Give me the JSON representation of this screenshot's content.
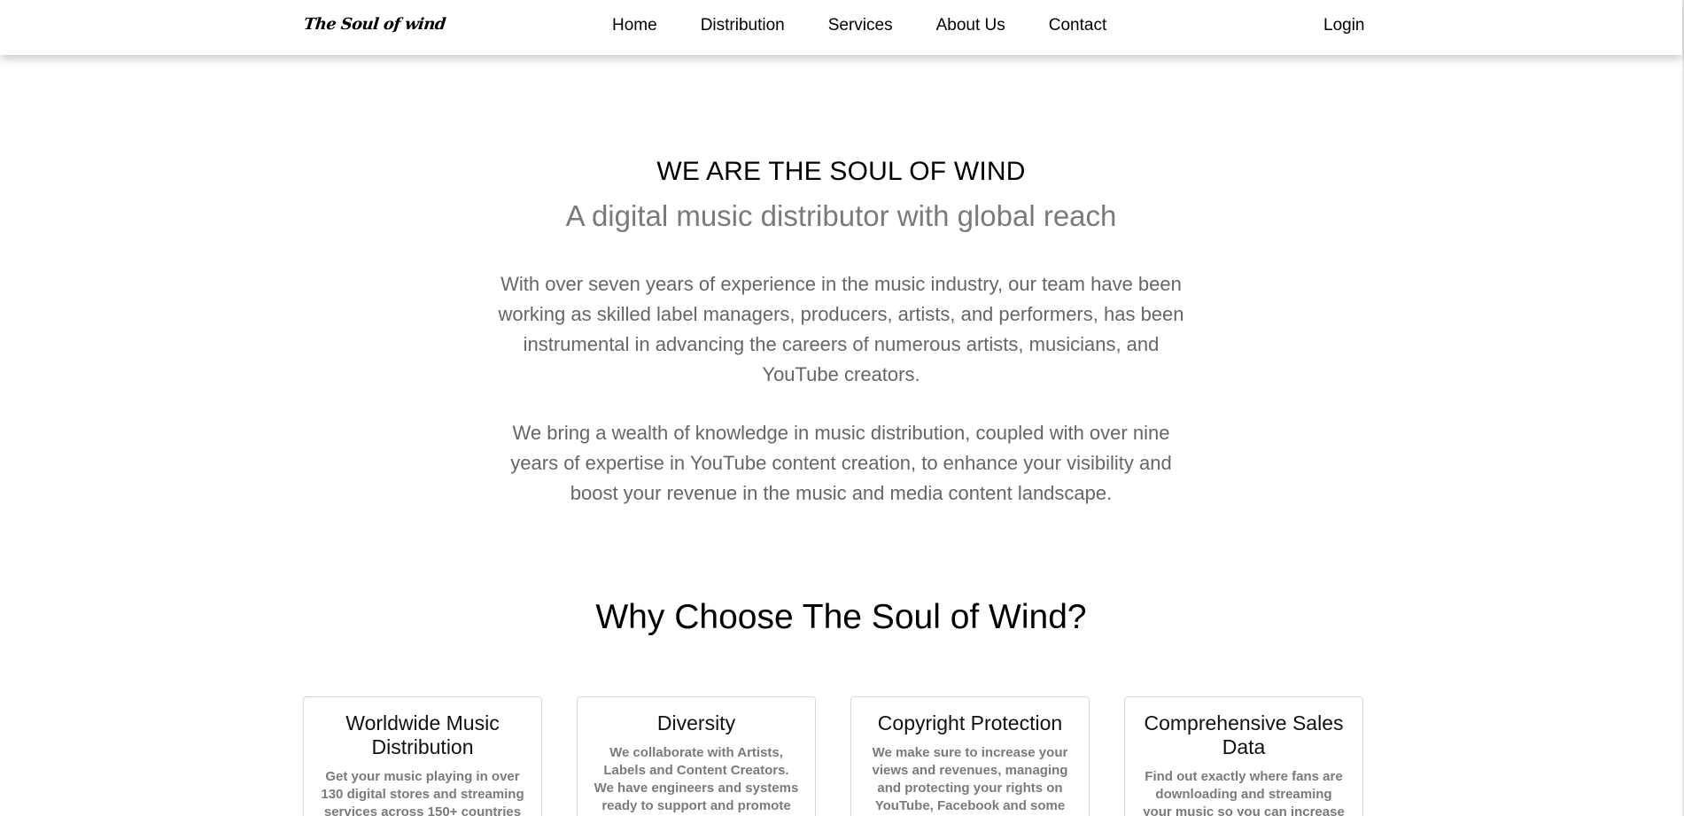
{
  "navbar": {
    "logo": "The Soul of wind",
    "links": [
      "Home",
      "Distribution",
      "Services",
      "About Us",
      "Contact"
    ],
    "login": "Login"
  },
  "hero": {
    "title": "WE ARE THE SOUL OF WIND",
    "subtitle": "A digital music distributor with global reach",
    "paragraph1": "With over seven years of experience in the music industry, our team have been working as skilled label managers, producers, artists, and performers, has been instrumental in advancing the careers of numerous artists, musicians, and YouTube creators.",
    "paragraph2": "We bring a wealth of knowledge in music distribution, coupled with over nine years of expertise in YouTube content creation, to enhance your visibility and boost your revenue in the music and media content landscape."
  },
  "why": {
    "title": "Why Choose The Soul of Wind?"
  },
  "cards": [
    {
      "title": "Worldwide Music Distribution",
      "text": "Get your music playing in over 130 digital stores and streaming services across 150+ countries"
    },
    {
      "title": "Diversity",
      "text": "We collaborate with Artists, Labels and Content Creators. We have engineers and systems ready to support and promote"
    },
    {
      "title": "Copyright Protection",
      "text": "We make sure to increase your views and revenues, managing and protecting your rights on YouTube, Facebook and some"
    },
    {
      "title": "Comprehensive Sales Data",
      "text": "Find out exactly where fans are downloading and streaming your music so you can increase"
    }
  ],
  "colors": {
    "subtitle": "#7a7a7a",
    "paragraph": "#666666",
    "card_border": "#d9d9d9"
  }
}
